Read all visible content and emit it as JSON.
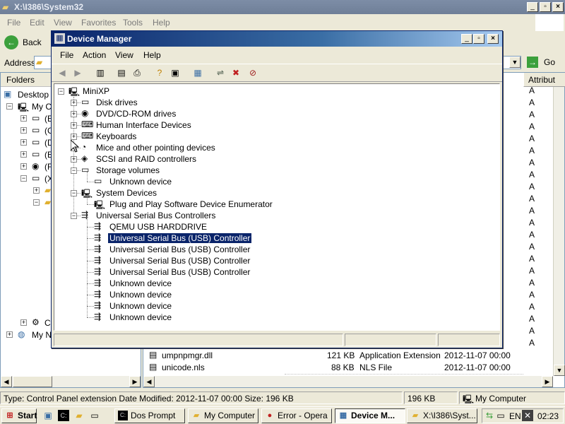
{
  "explorer": {
    "title": "X:\\I386\\System32",
    "menu": [
      "File",
      "Edit",
      "View",
      "Favorites",
      "Tools",
      "Help"
    ],
    "back_label": "Back",
    "address_label": "Address",
    "go_label": "Go",
    "folders_label": "Folders",
    "tree": [
      {
        "label": "Desktop"
      },
      {
        "label": "My C"
      },
      {
        "label": "(E"
      },
      {
        "label": "(C"
      },
      {
        "label": "(D"
      },
      {
        "label": "(E"
      },
      {
        "label": "(F"
      },
      {
        "label": "(X"
      },
      {
        "label": "C"
      },
      {
        "label": "My N"
      }
    ],
    "attrib_header": "Attribut",
    "attrib_value": "A",
    "files": [
      {
        "name": "umpnpmgr.dll",
        "size": "121 KB",
        "type": "Application Extension",
        "modified": "2012-11-07 00:00"
      },
      {
        "name": "unicode.nls",
        "size": "88 KB",
        "type": "NLS File",
        "modified": "2012-11-07 00:00"
      }
    ],
    "status": {
      "text": "Type: Control Panel extension Date Modified: 2012-11-07 00:00 Size: 196 KB",
      "size": "196 KB",
      "zone": "My Computer"
    }
  },
  "devmgr": {
    "title": "Device Manager",
    "menu": [
      "File",
      "Action",
      "View",
      "Help"
    ],
    "root": "MiniXP",
    "categories": [
      {
        "label": "Disk drives",
        "icon": "disk-icon",
        "expanded": false
      },
      {
        "label": "DVD/CD-ROM drives",
        "icon": "cdrom-icon",
        "expanded": false
      },
      {
        "label": "Human Interface Devices",
        "icon": "hid-icon",
        "expanded": false
      },
      {
        "label": "Keyboards",
        "icon": "keyboard-icon",
        "expanded": false
      },
      {
        "label": "Mice and other pointing devices",
        "icon": "mouse-icon",
        "expanded": false
      },
      {
        "label": "SCSI and RAID controllers",
        "icon": "scsi-icon",
        "expanded": false
      },
      {
        "label": "Storage volumes",
        "icon": "volume-icon",
        "expanded": true,
        "children": [
          "Unknown device"
        ]
      },
      {
        "label": "System Devices",
        "icon": "computer-icon",
        "expanded": true,
        "children": [
          "Plug and Play Software Device Enumerator"
        ]
      },
      {
        "label": "Universal Serial Bus Controllers",
        "icon": "usb-icon",
        "expanded": true,
        "children": [
          "QEMU USB HARDDRIVE",
          "Universal Serial Bus (USB) Controller",
          "Universal Serial Bus (USB) Controller",
          "Universal Serial Bus (USB) Controller",
          "Universal Serial Bus (USB) Controller",
          "Unknown device",
          "Unknown device",
          "Unknown device",
          "Unknown device"
        ]
      }
    ],
    "selected": "Universal Serial Bus (USB) Controller"
  },
  "taskbar": {
    "start": "Start",
    "tasks": [
      {
        "label": "Dos Prompt",
        "icon": "cmd-icon"
      },
      {
        "label": "My Computer",
        "icon": "folder-icon"
      },
      {
        "label": "Error - Opera",
        "icon": "opera-icon"
      },
      {
        "label": "Device M...",
        "icon": "devmgr-icon",
        "active": true
      },
      {
        "label": "X:\\I386\\Syst...",
        "icon": "folder-icon"
      }
    ],
    "lang": "EN",
    "clock": "02:23"
  }
}
